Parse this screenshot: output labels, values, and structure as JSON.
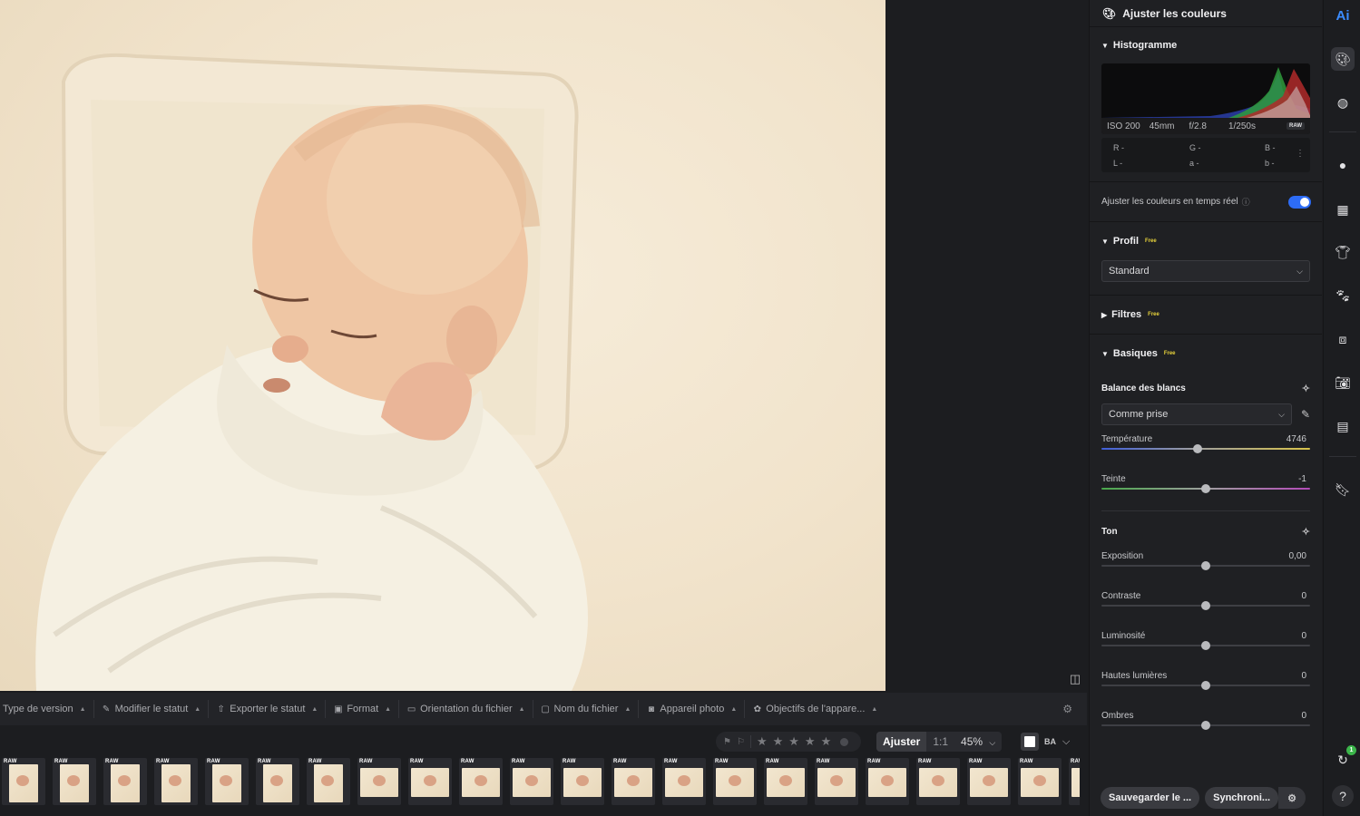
{
  "viewer": {
    "compare_icon": "split-view-icon"
  },
  "filterbar": {
    "filters": [
      {
        "label": "Type de version",
        "icon": ""
      },
      {
        "label": "Modifier le statut",
        "icon": "pencil-icon"
      },
      {
        "label": "Exporter le statut",
        "icon": "upload-icon"
      },
      {
        "label": "Format",
        "icon": "image-icon"
      },
      {
        "label": "Orientation du fichier",
        "icon": "orientation-icon"
      },
      {
        "label": "Nom du fichier",
        "icon": "folder-icon"
      },
      {
        "label": "Appareil photo",
        "icon": "camera-icon"
      },
      {
        "label": "Objectifs de l'appare...",
        "icon": "lens-icon"
      }
    ]
  },
  "viewbar": {
    "adjust_label": "Ajuster",
    "one_to_one": "1:1",
    "zoom": "45%",
    "ba_label": "BA",
    "stars": 5
  },
  "filmstrip": {
    "raw_label": "RAW",
    "thumbs": [
      "portrait",
      "portrait",
      "portrait",
      "portrait",
      "portrait",
      "portrait",
      "portrait",
      "landscape",
      "landscape",
      "landscape",
      "landscape",
      "landscape",
      "landscape",
      "landscape",
      "landscape",
      "landscape",
      "landscape",
      "landscape",
      "landscape",
      "landscape",
      "landscape",
      "landscape"
    ]
  },
  "panel": {
    "title": "Ajuster les couleurs",
    "histogram": {
      "title": "Histogramme",
      "iso": "ISO 200",
      "focal": "45mm",
      "aperture": "f/2.8",
      "shutter": "1/250s",
      "raw": "RAW",
      "readout": {
        "r": "R -",
        "g": "G -",
        "b": "B -",
        "l": "L -",
        "a": "a -",
        "bb": "b -"
      }
    },
    "realtime_label": "Ajuster les couleurs en temps réel",
    "realtime_on": true,
    "profile": {
      "title": "Profil",
      "free": "Free",
      "value": "Standard"
    },
    "filters": {
      "title": "Filtres",
      "free": "Free"
    },
    "basics": {
      "title": "Basiques",
      "free": "Free",
      "wb_title": "Balance des blancs",
      "wb_value": "Comme prise",
      "temperature": {
        "label": "Température",
        "value": "4746",
        "pos": 0.46
      },
      "tint": {
        "label": "Teinte",
        "value": "-1",
        "pos": 0.5
      },
      "tone_title": "Ton",
      "tone": [
        {
          "label": "Exposition",
          "value": "0,00",
          "pos": 0.5
        },
        {
          "label": "Contraste",
          "value": "0",
          "pos": 0.5
        },
        {
          "label": "Luminosité",
          "value": "0",
          "pos": 0.5
        },
        {
          "label": "Hautes lumières",
          "value": "0",
          "pos": 0.5
        },
        {
          "label": "Ombres",
          "value": "0",
          "pos": 0.5
        }
      ]
    },
    "footer": {
      "save": "Sauvegarder le ...",
      "sync": "Synchroni..."
    }
  },
  "rail": {
    "ai_label": "Ai",
    "badge": "1",
    "help": "?"
  }
}
